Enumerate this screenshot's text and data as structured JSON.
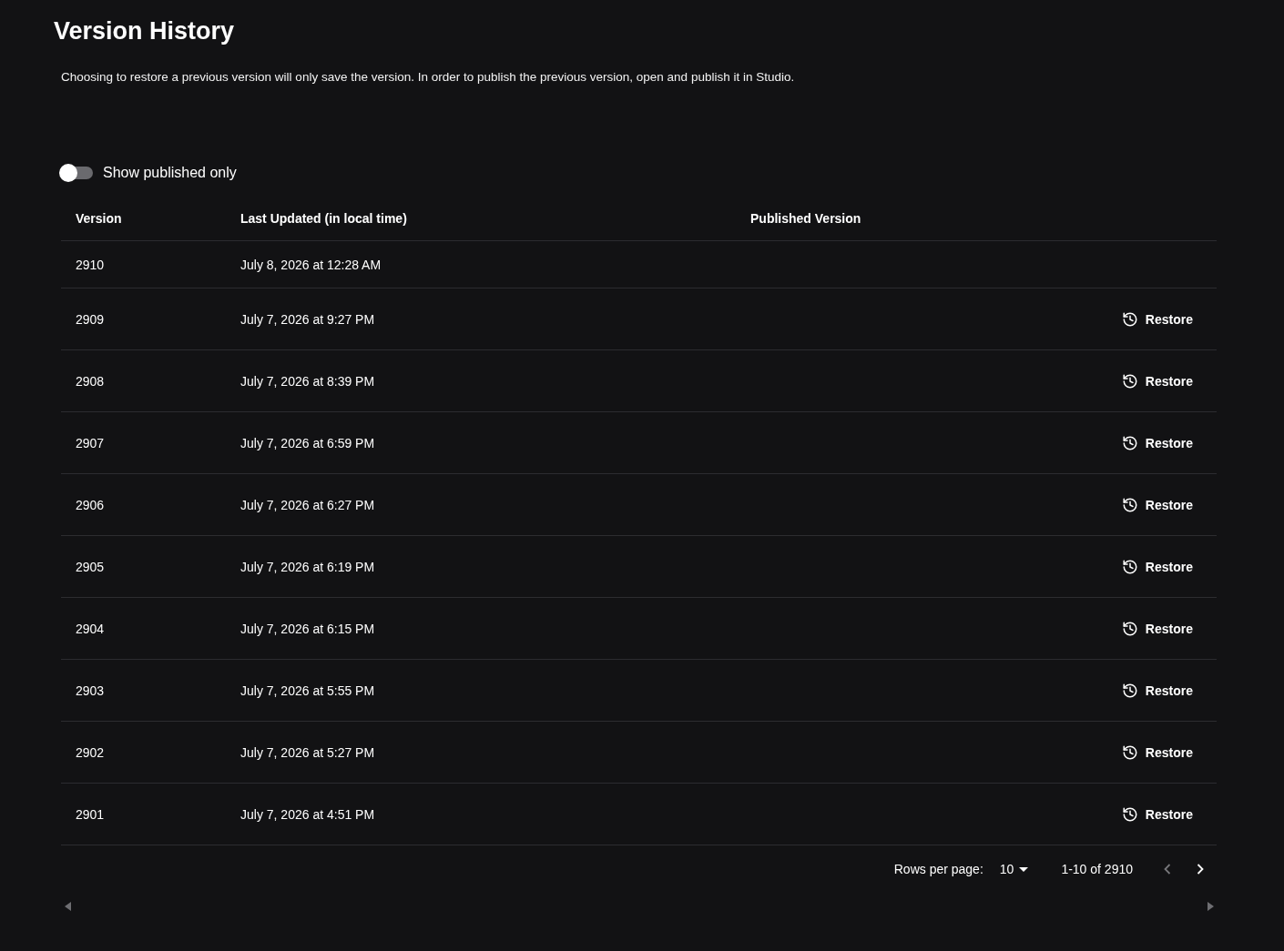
{
  "page": {
    "title": "Version History",
    "description": "Choosing to restore a previous version will only save the version. In order to publish the previous version, open and publish it in Studio."
  },
  "toggle": {
    "label": "Show published only",
    "on": false
  },
  "table": {
    "columns": [
      "Version",
      "Last Updated (in local time)",
      "Published Version"
    ],
    "rows": [
      {
        "version": "2910",
        "updated": "July 8, 2026 at 12:28 AM"
      },
      {
        "version": "2909",
        "updated": "July 7, 2026 at 9:27 PM",
        "action": "Restore"
      },
      {
        "version": "2908",
        "updated": "July 7, 2026 at 8:39 PM",
        "action": "Restore"
      },
      {
        "version": "2907",
        "updated": "July 7, 2026 at 6:59 PM",
        "action": "Restore"
      },
      {
        "version": "2906",
        "updated": "July 7, 2026 at 6:27 PM",
        "action": "Restore"
      },
      {
        "version": "2905",
        "updated": "July 7, 2026 at 6:19 PM",
        "action": "Restore"
      },
      {
        "version": "2904",
        "updated": "July 7, 2026 at 6:15 PM",
        "action": "Restore"
      },
      {
        "version": "2903",
        "updated": "July 7, 2026 at 5:55 PM",
        "action": "Restore"
      },
      {
        "version": "2902",
        "updated": "July 7, 2026 at 5:27 PM",
        "action": "Restore"
      },
      {
        "version": "2901",
        "updated": "July 7, 2026 at 4:51 PM",
        "action": "Restore"
      }
    ]
  },
  "pagination": {
    "rows_per_page_label": "Rows per page:",
    "rows_per_page": "10",
    "range": "1-10 of 2910",
    "previous": {
      "disabled": true
    },
    "next": {
      "disabled": false
    }
  }
}
